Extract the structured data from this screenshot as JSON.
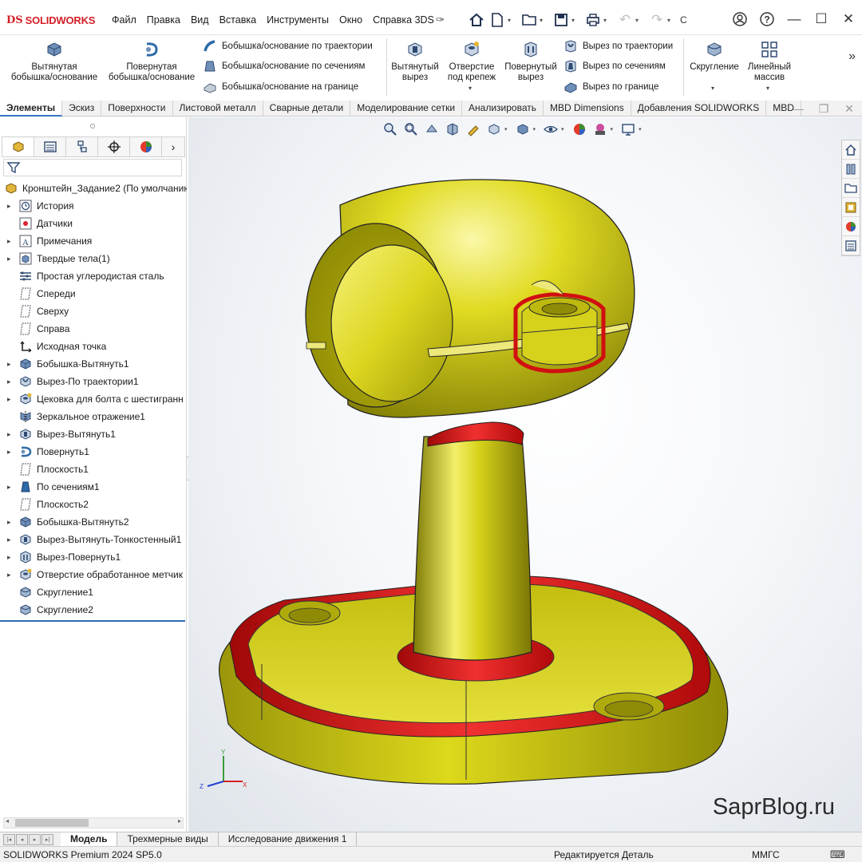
{
  "app": {
    "logo_ds": "DS",
    "logo_brand": "SOLIDWORKS",
    "menu": [
      "Файл",
      "Правка",
      "Вид",
      "Вставка",
      "Инструменты",
      "Окно",
      "Справка 3DS"
    ],
    "search_stub": "С"
  },
  "ribbon": {
    "extruded_boss": "Вытянутая\nбобышка/основание",
    "revolved_boss": "Повернутая\nбобышка/основание",
    "swept_boss": "Бобышка/основание по траектории",
    "lofted_boss": "Бобышка/основание по сечениям",
    "boundary_boss": "Бобышка/основание на границе",
    "extruded_cut": "Вытянутый\nвырез",
    "hole_wizard": "Отверстие\nпод крепеж",
    "revolved_cut": "Повернутый\nвырез",
    "swept_cut": "Вырез по траектории",
    "lofted_cut": "Вырез по сечениям",
    "boundary_cut": "Вырез по границе",
    "fillet": "Скругление",
    "linear_pattern": "Линейный\nмассив"
  },
  "command_tabs": [
    "Элементы",
    "Эскиз",
    "Поверхности",
    "Листовой металл",
    "Сварные детали",
    "Моделирование сетки",
    "Анализировать",
    "MBD Dimensions",
    "Добавления SOLIDWORKS",
    "MBD"
  ],
  "tree": {
    "root": "Кронштейн_Задание2 (По умолчанию",
    "items": [
      {
        "label": "История",
        "icon": "history",
        "exp": true
      },
      {
        "label": "Датчики",
        "icon": "sensor",
        "exp": false
      },
      {
        "label": "Примечания",
        "icon": "annot",
        "exp": true
      },
      {
        "label": "Твердые тела(1)",
        "icon": "solid",
        "exp": true
      },
      {
        "label": "Простая углеродистая сталь",
        "icon": "material",
        "exp": false
      },
      {
        "label": "Спереди",
        "icon": "plane",
        "exp": false
      },
      {
        "label": "Сверху",
        "icon": "plane",
        "exp": false
      },
      {
        "label": "Справа",
        "icon": "plane",
        "exp": false
      },
      {
        "label": "Исходная точка",
        "icon": "origin",
        "exp": false
      },
      {
        "label": "Бобышка-Вытянуть1",
        "icon": "extrude",
        "exp": true
      },
      {
        "label": "Вырез-По траектории1",
        "icon": "sweepcut",
        "exp": true
      },
      {
        "label": "Цековка для  болта с шестигранн",
        "icon": "hole",
        "exp": true
      },
      {
        "label": "Зеркальное отражение1",
        "icon": "mirror",
        "exp": false
      },
      {
        "label": "Вырез-Вытянуть1",
        "icon": "cut",
        "exp": true
      },
      {
        "label": "Повернуть1",
        "icon": "revolve",
        "exp": true
      },
      {
        "label": "Плоскость1",
        "icon": "plane",
        "exp": false
      },
      {
        "label": "По сечениям1",
        "icon": "loft",
        "exp": true
      },
      {
        "label": "Плоскость2",
        "icon": "plane",
        "exp": false
      },
      {
        "label": "Бобышка-Вытянуть2",
        "icon": "extrude",
        "exp": true
      },
      {
        "label": "Вырез-Вытянуть-Тонкостенный1",
        "icon": "cut",
        "exp": true
      },
      {
        "label": "Вырез-Повернуть1",
        "icon": "revcut",
        "exp": true
      },
      {
        "label": "Отверстие обработанное метчик",
        "icon": "hole",
        "exp": true
      },
      {
        "label": "Скругление1",
        "icon": "fillet",
        "exp": false
      },
      {
        "label": "Скругление2",
        "icon": "fillet",
        "exp": false
      }
    ]
  },
  "viewport": {
    "watermark": "SaprBlog.ru",
    "axis_x": "X",
    "axis_y": "Y",
    "axis_z": "Z"
  },
  "sheet_tabs": [
    "Модель",
    "Трехмерные виды",
    "Исследование движения 1"
  ],
  "status": {
    "product": "SOLIDWORKS Premium 2024 SP5.0",
    "state": "Редактируется Деталь",
    "units": "ММГС"
  },
  "colors": {
    "body": "#d6d200",
    "fillet": "#e01010",
    "brand": "#d31f26",
    "accent": "#3874c8"
  }
}
